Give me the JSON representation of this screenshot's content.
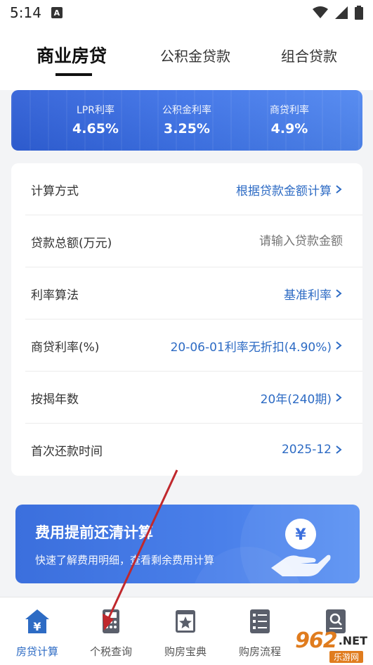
{
  "status_bar": {
    "time": "5:14",
    "notif_letter": "A"
  },
  "tabs": [
    {
      "label": "商业房贷",
      "active": true
    },
    {
      "label": "公积金贷款",
      "active": false
    },
    {
      "label": "组合贷款",
      "active": false
    }
  ],
  "rates": [
    {
      "label": "LPR利率",
      "value": "4.65%"
    },
    {
      "label": "公积金利率",
      "value": "3.25%"
    },
    {
      "label": "商贷利率",
      "value": "4.9%"
    }
  ],
  "form": {
    "calc_method": {
      "label": "计算方式",
      "value": "根据贷款金额计算"
    },
    "loan_amount": {
      "label": "贷款总额(万元)",
      "placeholder": "请输入贷款金额"
    },
    "rate_method": {
      "label": "利率算法",
      "value": "基准利率"
    },
    "commercial_rate": {
      "label": "商贷利率(%)",
      "value": "20-06-01利率无折扣(4.90%)"
    },
    "years": {
      "label": "按揭年数",
      "value": "20年(240期)"
    },
    "first_payment": {
      "label": "首次还款时间",
      "value": "2025-12"
    }
  },
  "promo": {
    "title": "费用提前还清计算",
    "subtitle": "快速了解费用明细，查看剩余费用计算",
    "icon_symbol": "¥"
  },
  "bottom_nav": [
    {
      "label": "房贷计算",
      "icon": "house-yen-icon",
      "active": true
    },
    {
      "label": "个税查询",
      "icon": "calculator-icon",
      "active": false
    },
    {
      "label": "购房宝典",
      "icon": "book-star-icon",
      "active": false
    },
    {
      "label": "购房流程",
      "icon": "checklist-icon",
      "active": false
    },
    {
      "label": "",
      "icon": "search-doc-icon",
      "active": false
    }
  ],
  "watermark": {
    "main": "962",
    "net": ".NET",
    "sub": "乐游网"
  },
  "colors": {
    "accent": "#2d6bc4",
    "banner_start": "#2f5fd7",
    "banner_end": "#4f86f0",
    "annotation_arrow": "#c0282d"
  }
}
